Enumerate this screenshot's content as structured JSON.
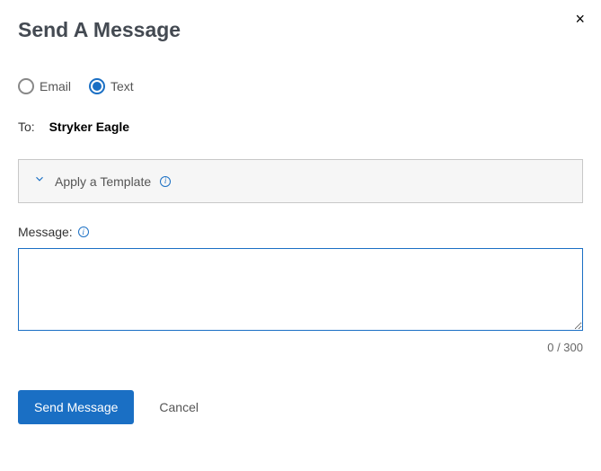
{
  "dialog": {
    "title": "Send A Message",
    "close_label": "×"
  },
  "channel": {
    "options": [
      {
        "label": "Email",
        "selected": false
      },
      {
        "label": "Text",
        "selected": true
      }
    ]
  },
  "recipient": {
    "label": "To:",
    "name": "Stryker Eagle"
  },
  "template": {
    "label": "Apply a Template"
  },
  "message": {
    "label": "Message:",
    "value": "",
    "counter": "0 / 300"
  },
  "actions": {
    "send": "Send Message",
    "cancel": "Cancel"
  }
}
